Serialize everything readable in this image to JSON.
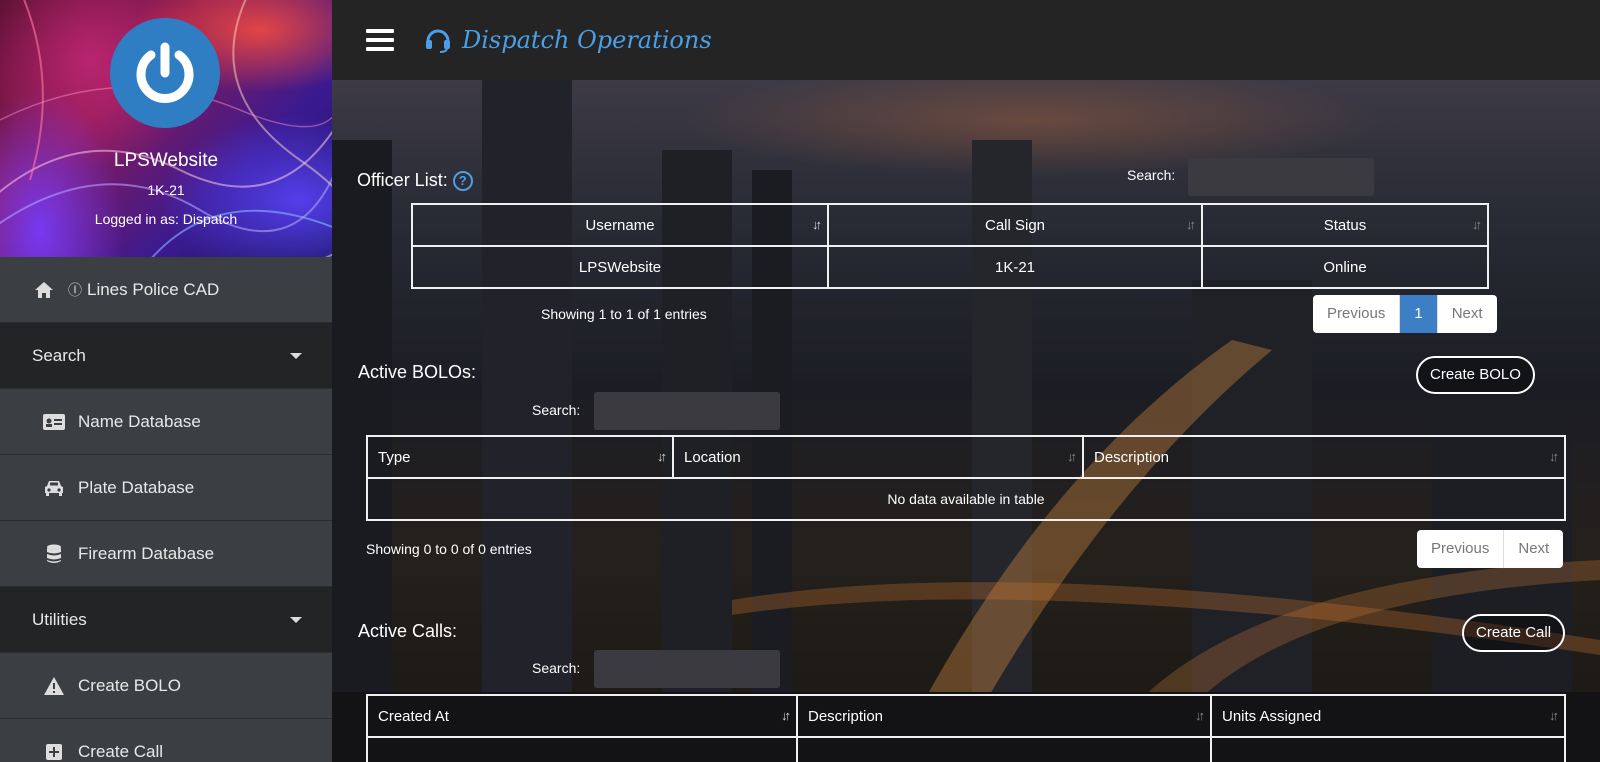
{
  "profile": {
    "name": "LPSWebsite",
    "callsign": "1K-21",
    "login": "Logged in as: Dispatch"
  },
  "nav": {
    "home": "Lines Police CAD",
    "search_section": "Search",
    "name_db": "Name Database",
    "plate_db": "Plate Database",
    "firearm_db": "Firearm Database",
    "utilities_section": "Utilities",
    "create_bolo": "Create BOLO",
    "create_call": "Create Call"
  },
  "header": {
    "title": "Dispatch Operations"
  },
  "officers": {
    "title": "Officer List:",
    "help": "?",
    "search_label": "Search:",
    "columns": [
      "Username",
      "Call Sign",
      "Status"
    ],
    "rows": [
      [
        "LPSWebsite",
        "1K-21",
        "Online"
      ]
    ],
    "info": "Showing 1 to 1 of 1 entries",
    "prev": "Previous",
    "page": "1",
    "next": "Next"
  },
  "bolos": {
    "title": "Active BOLOs:",
    "search_label": "Search:",
    "create_btn": "Create BOLO",
    "columns": [
      "Type",
      "Location",
      "Description"
    ],
    "empty": "No data available in table",
    "info": "Showing 0 to 0 of 0 entries",
    "prev": "Previous",
    "next": "Next"
  },
  "calls": {
    "title": "Active Calls:",
    "search_label": "Search:",
    "create_btn": "Create Call",
    "columns": [
      "Created At",
      "Description",
      "Units Assigned"
    ]
  },
  "colors": {
    "accent": "#4a9fe6",
    "pager_active": "#3d7fc4",
    "sidebar": "#3b3f43",
    "section": "#222426"
  },
  "icons": [
    "power-icon",
    "home-icon",
    "id-card-icon",
    "car-icon",
    "database-icon",
    "warning-icon",
    "plus-square-icon",
    "headset-icon",
    "menu-icon",
    "sort-icon"
  ]
}
